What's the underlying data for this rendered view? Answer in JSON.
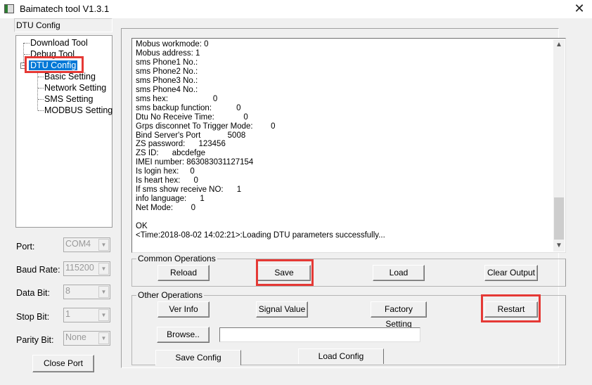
{
  "window": {
    "title": "Baimatech tool V1.3.1",
    "close_icon": "close-icon"
  },
  "sidebar": {
    "header": "DTU Config",
    "tree": [
      {
        "label": "Download Tool",
        "level": 0
      },
      {
        "label": "Debug Tool",
        "level": 0
      },
      {
        "label": "DTU Config",
        "level": 0,
        "selected": true,
        "expanded": true
      },
      {
        "label": "Basic Setting",
        "level": 1
      },
      {
        "label": "Network Setting",
        "level": 1
      },
      {
        "label": "SMS Setting",
        "level": 1
      },
      {
        "label": "MODBUS Setting",
        "level": 1
      }
    ],
    "fields": [
      {
        "label": "Port:",
        "value": "COM4"
      },
      {
        "label": "Baud Rate:",
        "value": "115200"
      },
      {
        "label": "Data Bit:",
        "value": "8"
      },
      {
        "label": "Stop Bit:",
        "value": "1"
      },
      {
        "label": "Parity Bit:",
        "value": "None"
      }
    ],
    "close_port": "Close Port"
  },
  "output": {
    "lines": "Mobus workmode: 0\nMobus address: 1\nsms Phone1 No.:\nsms Phone2 No.:\nsms Phone3 No.:\nsms Phone4 No.:\nsms hex:                    0\nsms backup function:           0\nDtu No Receive Time:             0\nGrps disconnet To Trigger Mode:        0\nBind Server's Port            5008\nZS password:      123456\nZS ID:      abcdefge\nIMEI number: 863083031127154\nIs login hex:     0\nIs heart hex:      0\nIf sms show receive NO:      1\ninfo language:      1\nNet Mode:        0\n\nOK\n<Time:2018-08-02 14:02:21>:Loading DTU parameters successfully..."
  },
  "common_ops": {
    "title": "Common Operations",
    "reload": "Reload",
    "save": "Save",
    "load": "Load",
    "clear_output": "Clear Output"
  },
  "other_ops": {
    "title": "Other Operations",
    "ver_info": "Ver Info",
    "signal_value": "Signal Value",
    "factory_setting": "Factory Setting",
    "restart": "Restart",
    "browse": "Browse..",
    "path_value": "",
    "save_config": "Save Config",
    "load_config": "Load Config"
  },
  "highlight_color": "#e53935",
  "selection_color": "#0078d7"
}
